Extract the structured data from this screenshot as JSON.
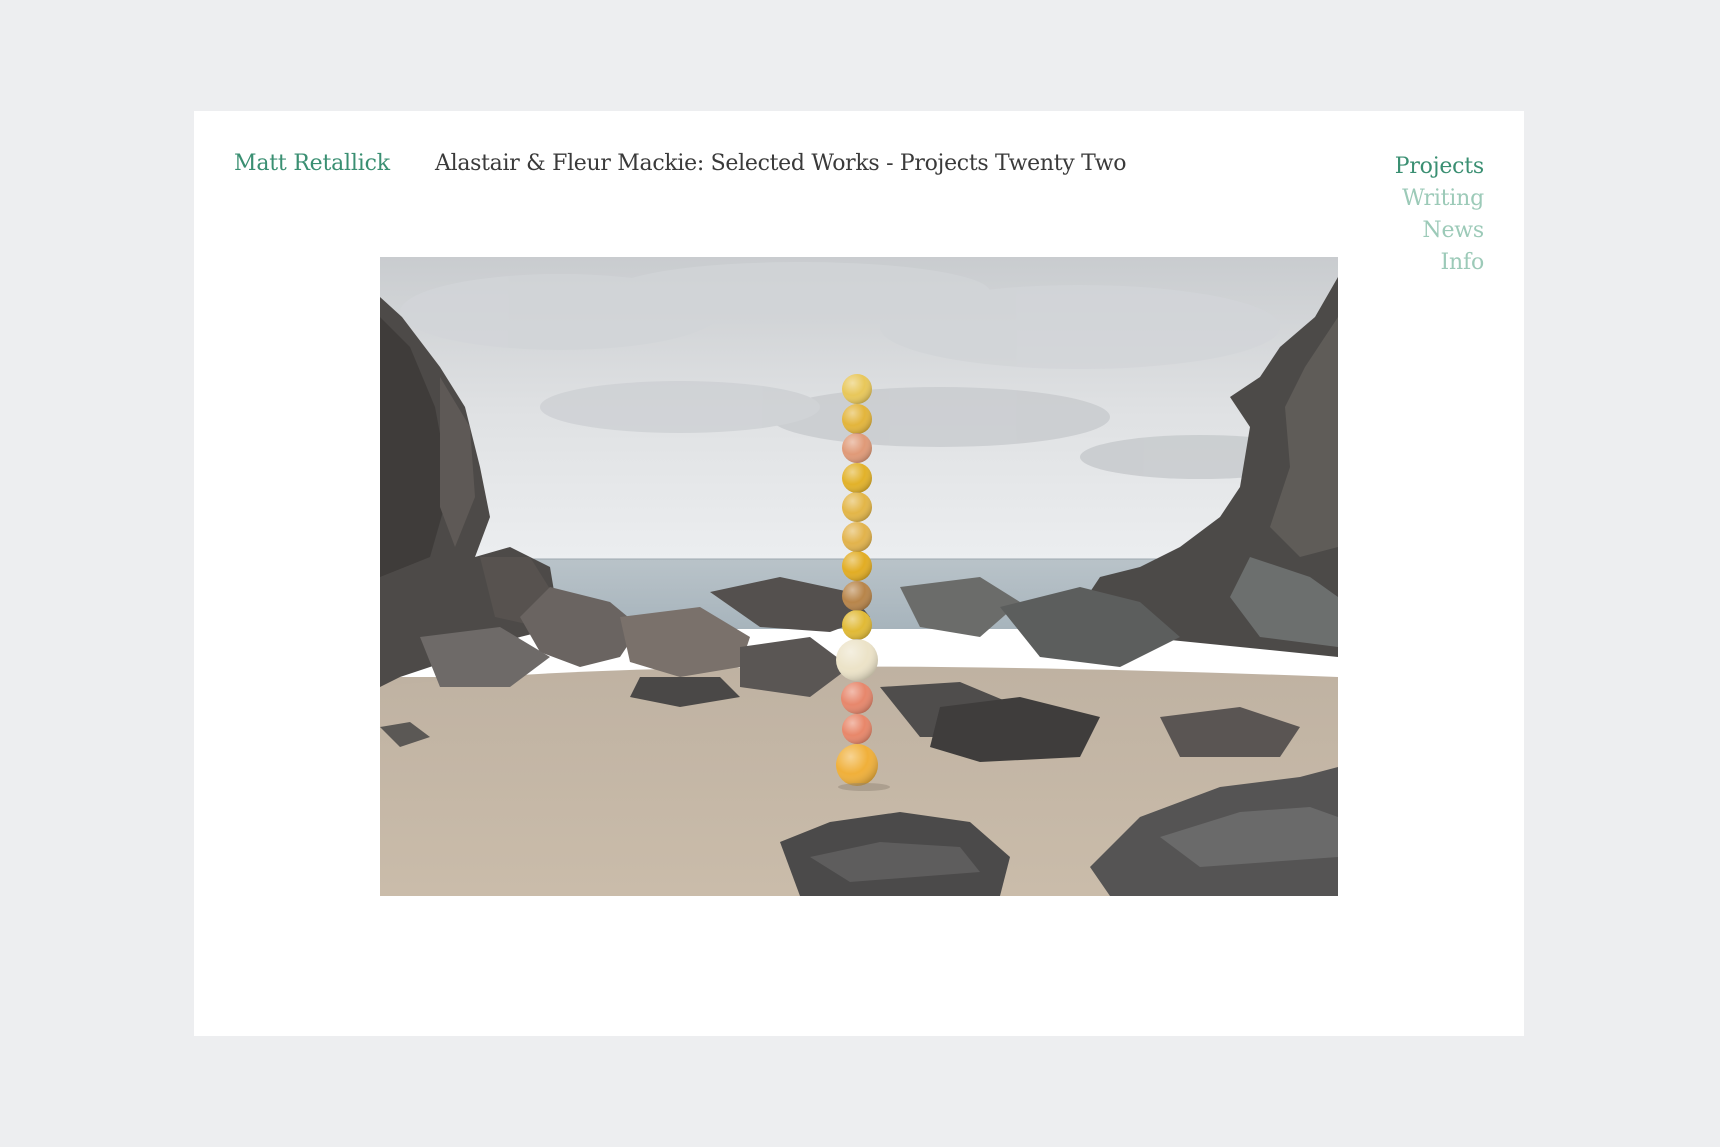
{
  "site": {
    "name": "Matt Retallick"
  },
  "project": {
    "title": "Alastair & Fleur Mackie: Selected Works - Projects Twenty Two"
  },
  "nav": {
    "items": [
      {
        "label": "Projects",
        "active": true
      },
      {
        "label": "Writing",
        "active": false
      },
      {
        "label": "News",
        "active": false
      },
      {
        "label": "Info",
        "active": false
      }
    ]
  },
  "colors": {
    "page_background": "#edeef0",
    "card_background": "#ffffff",
    "accent": "#3a8f72",
    "accent_light": "#9ccab8",
    "title_text": "#3a3a3a"
  },
  "sculpture": {
    "sphere_colors": [
      "#e8c75a",
      "#e3b53c",
      "#e09a78",
      "#e2b22a",
      "#e3b648",
      "#e2b34c",
      "#e2ad24",
      "#b8854a",
      "#e1ba36",
      "#ece3c8",
      "#e7876c",
      "#e8876a",
      "#f0b03a"
    ]
  }
}
